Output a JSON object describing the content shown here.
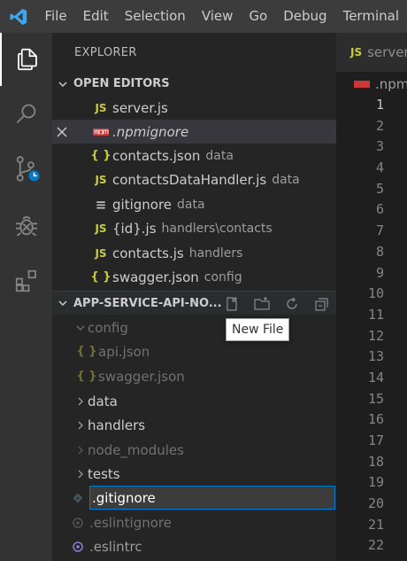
{
  "menubar": {
    "items": [
      "File",
      "Edit",
      "Selection",
      "View",
      "Go",
      "Debug",
      "Terminal"
    ]
  },
  "activity_bar": {
    "icons": [
      "explorer-icon",
      "search-icon",
      "source-control-icon",
      "debug-icon",
      "extensions-icon"
    ]
  },
  "sidebar": {
    "title": "EXPLORER",
    "open_editors": {
      "header": "OPEN EDITORS",
      "items": [
        {
          "name": "server.js",
          "desc": "",
          "icon": "JS"
        },
        {
          "name": ".npmignore",
          "desc": "",
          "icon": "npm"
        },
        {
          "name": "contacts.json",
          "desc": "data",
          "icon": "{}"
        },
        {
          "name": "contactsDataHandler.js",
          "desc": "data",
          "icon": "JS"
        },
        {
          "name": "gitignore",
          "desc": "data",
          "icon": "≡"
        },
        {
          "name": "{id}.js",
          "desc": "handlers\\contacts",
          "icon": "JS"
        },
        {
          "name": "contacts.js",
          "desc": "handlers",
          "icon": "JS"
        },
        {
          "name": "swagger.json",
          "desc": "config",
          "icon": "{}"
        }
      ]
    },
    "project": {
      "header": "APP-SERVICE-API-NO...",
      "tree": [
        {
          "name": "config",
          "type": "folder-open"
        },
        {
          "name": "api.json",
          "type": "json"
        },
        {
          "name": "swagger.json",
          "type": "json"
        },
        {
          "name": "data",
          "type": "folder"
        },
        {
          "name": "handlers",
          "type": "folder"
        },
        {
          "name": "node_modules",
          "type": "folder"
        },
        {
          "name": "tests",
          "type": "folder"
        },
        {
          "name": ".eslintignore",
          "type": "file"
        },
        {
          "name": ".eslintrc",
          "type": "file"
        }
      ],
      "new_file_input_value": ".gitignore"
    },
    "tooltip": "New File"
  },
  "editor": {
    "tab_label": "server",
    "breadcrumb": ".npm",
    "line_numbers": [
      "1",
      "2",
      "3",
      "4",
      "5",
      "6",
      "7",
      "8",
      "9",
      "10",
      "11",
      "12",
      "13",
      "14",
      "15",
      "16",
      "17",
      "18",
      "19",
      "20",
      "21",
      "22"
    ]
  },
  "colors": {
    "accent": "#007acc",
    "js_yellow": "#cbcb41",
    "npm_red": "#cb3837"
  }
}
